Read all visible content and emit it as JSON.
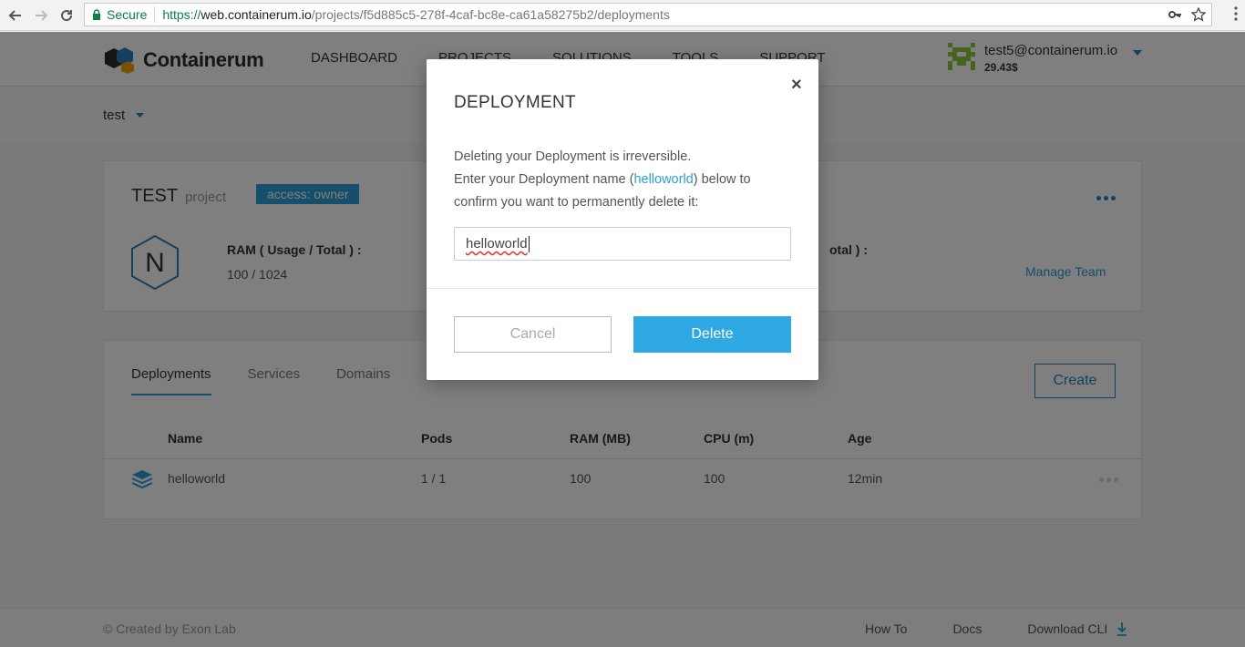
{
  "browser": {
    "secure_label": "Secure",
    "url_scheme": "https://",
    "url_host": "web.containerum.io",
    "url_path": "/projects/f5d885c5-278f-4caf-bc8e-ca61a58275b2/deployments"
  },
  "header": {
    "brand": "Containerum",
    "nav": [
      "DASHBOARD",
      "PROJECTS",
      "SOLUTIONS",
      "TOOLS",
      "SUPPORT"
    ],
    "user_email": "test5@containerum.io",
    "user_balance": "29.43$"
  },
  "subbar": {
    "project_name": "test"
  },
  "project": {
    "title": "TEST",
    "subtitle": "project",
    "access_badge": "access: owner",
    "avatar_letter": "N",
    "ram_label": "RAM ( Usage / Total ) :",
    "ram_value": "100 / 1024",
    "cpu_label_fragment": "otal ) :",
    "manage_team": "Manage Team"
  },
  "deployments": {
    "tabs": [
      "Deployments",
      "Services",
      "Domains"
    ],
    "create_label": "Create",
    "columns": [
      "Name",
      "Pods",
      "RAM (MB)",
      "CPU (m)",
      "Age"
    ],
    "rows": [
      {
        "name": "helloworld",
        "pods": "1 / 1",
        "ram": "100",
        "cpu": "100",
        "age": "12min"
      }
    ]
  },
  "footer": {
    "copyright": "© Created by Exon Lab",
    "links": [
      "How To",
      "Docs",
      "Download CLI"
    ]
  },
  "modal": {
    "title": "DEPLOYMENT",
    "close_glyph": "×",
    "line1": "Deleting your Deployment is irreversible.",
    "line2_pre": "Enter your Deployment name (",
    "line2_name": "helloworld",
    "line2_post": ") below to confirm you want to permanently delete it:",
    "input_value": "helloworld",
    "cancel_label": "Cancel",
    "delete_label": "Delete"
  },
  "colors": {
    "accent": "#2a9fd6",
    "delete_button": "#2fa9e4",
    "secure_green": "#0b8043"
  },
  "icons": [
    "back-arrow-icon",
    "forward-arrow-icon",
    "reload-icon",
    "lock-icon",
    "key-icon",
    "star-icon",
    "kebab-menu-icon",
    "caret-down-icon",
    "hexagon-avatar-icon",
    "stack-layers-icon",
    "download-icon",
    "close-icon"
  ]
}
